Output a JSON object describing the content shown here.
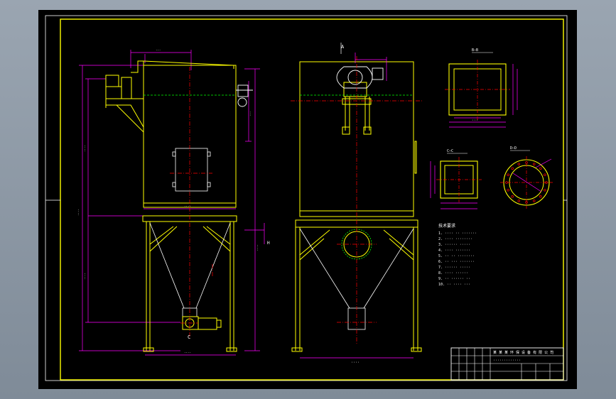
{
  "drawing": {
    "colors": {
      "background": "#000000",
      "frame": "#ffffff",
      "border": "#ffff00",
      "structure": "#ffff00",
      "dimensions": "#ff00ff",
      "centerline": "#ff0000",
      "hidden": "#00ff00",
      "equipment": "#ffffff"
    },
    "view_labels": {
      "side_marker": "A",
      "bottom_marker": "C",
      "height_dim": "H"
    },
    "section_labels": {
      "top_right": "B—B",
      "left_small": "C—C",
      "right_round": "D—D"
    },
    "notes": {
      "heading": "技术要求",
      "lines": [
        "1. ···· ·· ·······",
        "2. ···· ········",
        "3. ······ ·····",
        "4. ···· ·······",
        "5. ·· ·· ········",
        "6. ·· ··· ·······",
        "7. ······ ·····",
        "8. ···· ······",
        "9. ·· ······ ··",
        "10. ·· ···· ···"
      ]
    },
    "title_block": {
      "company": "某 某 某 环 保 设 备 有 限 公 司",
      "drawing_name": "·············",
      "cells": [
        "",
        "",
        "",
        ""
      ]
    }
  }
}
